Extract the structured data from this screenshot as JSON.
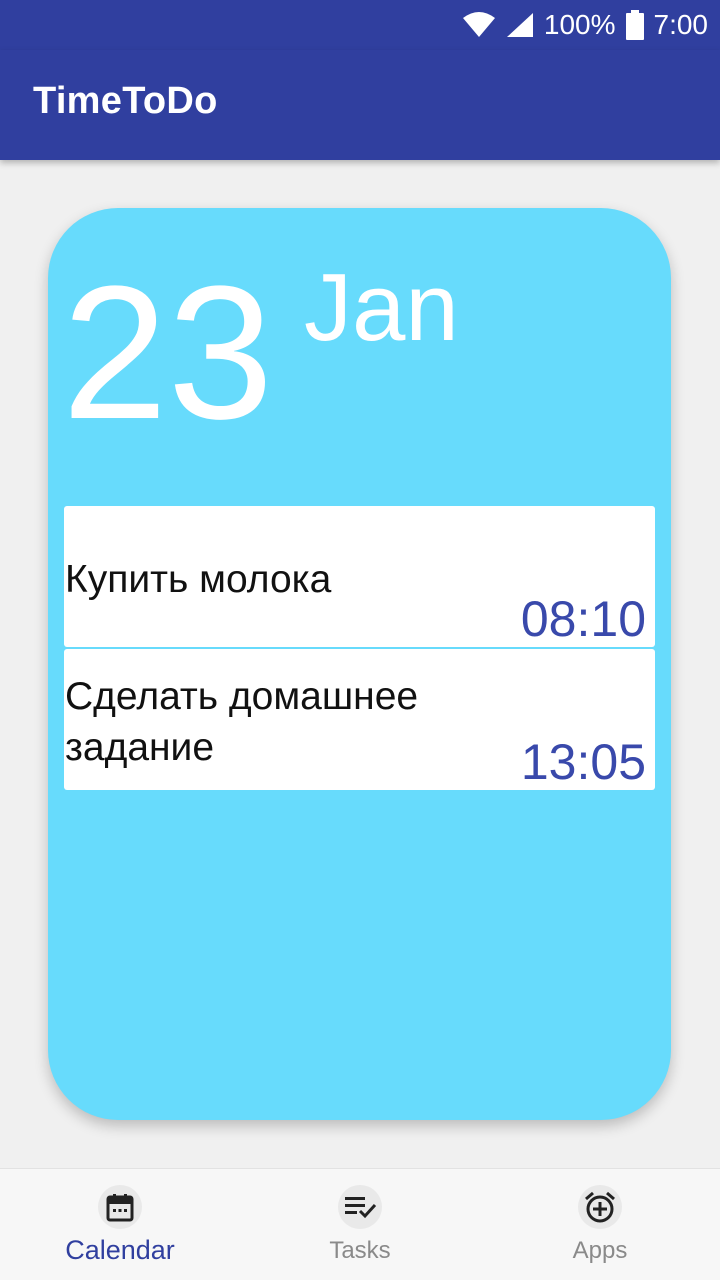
{
  "status_bar": {
    "battery": "100%",
    "time": "7:00",
    "icons": [
      "wifi-icon",
      "signal-icon",
      "battery-icon"
    ]
  },
  "app_bar": {
    "title": "TimeToDo"
  },
  "day_card": {
    "day": "23",
    "month": "Jan",
    "tasks": [
      {
        "title": "Купить молока",
        "time": "08:10"
      },
      {
        "title": "Сделать домашнее задание",
        "time": "13:05"
      }
    ]
  },
  "bottom_nav": {
    "items": [
      {
        "label": "Calendar",
        "icon": "calendar-icon",
        "active": true
      },
      {
        "label": "Tasks",
        "icon": "tasks-icon",
        "active": false
      },
      {
        "label": "Apps",
        "icon": "alarm-add-icon",
        "active": false
      }
    ]
  },
  "colors": {
    "primary": "#303f9f",
    "card": "#67dbfc",
    "time_text": "#3949ab",
    "background": "#f0f0f0"
  }
}
